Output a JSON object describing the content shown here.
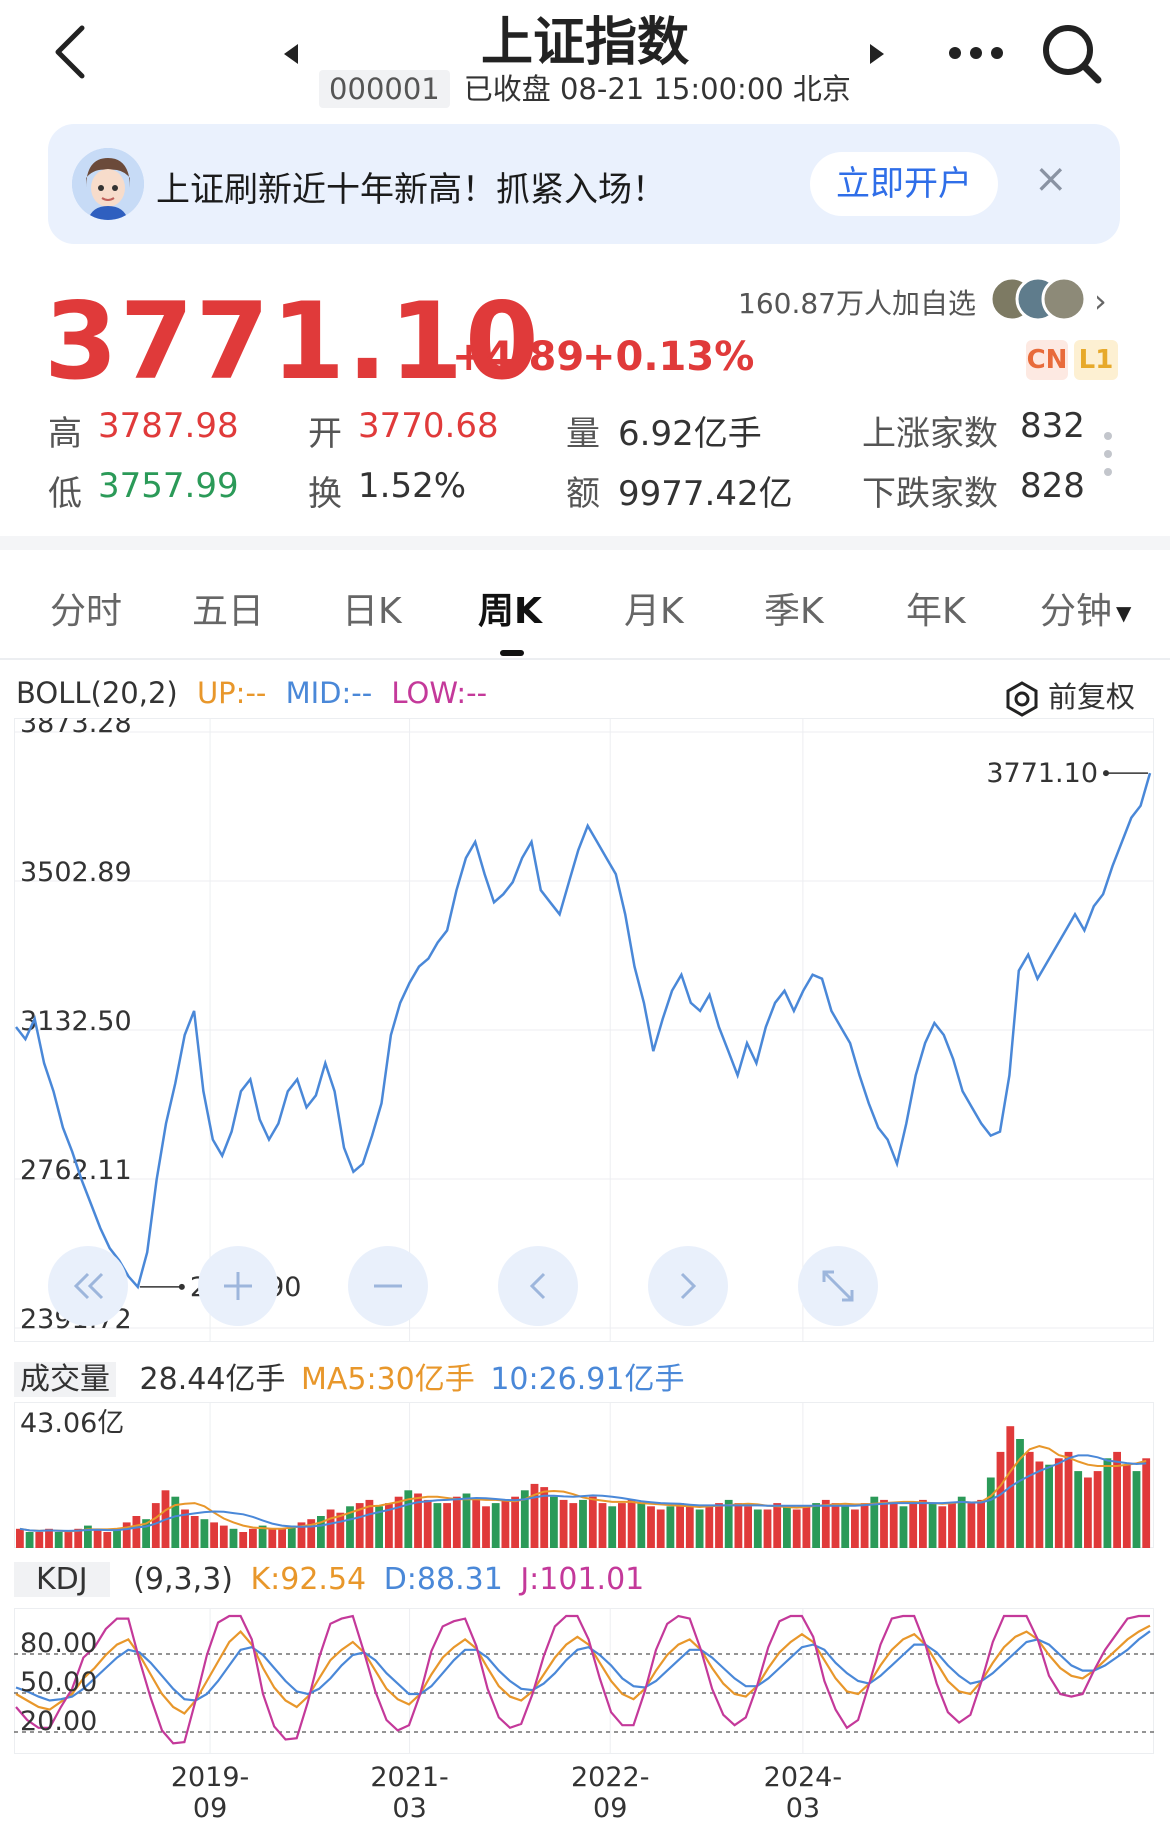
{
  "header": {
    "title": "上证指数",
    "code": "000001",
    "status": "已收盘 08-21 15:00:00 北京"
  },
  "banner": {
    "text": "上证刷新近十年新高！抓紧入场！",
    "button": "立即开户",
    "close": "×"
  },
  "quote": {
    "price": "3771.10",
    "change": "+4.89",
    "change_pct": "+0.13%",
    "watchers": "160.87万人加自选",
    "badge_cn": "CN",
    "badge_l1": "L1"
  },
  "stats": {
    "high_label": "高",
    "high": "3787.98",
    "open_label": "开",
    "open": "3770.68",
    "volume_label": "量",
    "volume": "6.92亿手",
    "up_label": "上涨家数",
    "up": "832",
    "low_label": "低",
    "low": "3757.99",
    "turnover_label": "换",
    "turnover": "1.52%",
    "amount_label": "额",
    "amount": "9977.42亿",
    "down_label": "下跌家数",
    "down": "828"
  },
  "tabs": [
    "分时",
    "五日",
    "日K",
    "周K",
    "月K",
    "季K",
    "年K",
    "分钟"
  ],
  "active_tab": "周K",
  "indicators": {
    "boll_label": "BOLL(20,2)",
    "boll_up": "UP:--",
    "boll_mid": "MID:--",
    "boll_low": "LOW:--",
    "adjust": "前复权",
    "vol_label": "成交量",
    "vol_value": "28.44亿手",
    "vol_ma5": "MA5:30亿手",
    "vol_ma10": "10:26.91亿手",
    "kdj_label": "KDJ",
    "kdj_params": "(9,3,3)",
    "kdj_k": "K:92.54",
    "kdj_d": "D:88.31",
    "kdj_j": "J:101.01"
  },
  "colors": {
    "up": "#e03a3a",
    "down": "#2b9a58",
    "line": "#4a88d8",
    "boll_up": "#e8972b",
    "boll_mid": "#4a88d8",
    "boll_low": "#c4399a"
  },
  "chart_data": [
    {
      "type": "line",
      "yticks": [
        "3873.28",
        "3502.89",
        "3132.50",
        "2762.11",
        "2391.72"
      ],
      "ylim": [
        2391.72,
        3873.28
      ],
      "x": [
        "2019-09",
        "2021-03",
        "2022-09",
        "2024-03"
      ],
      "annotations": {
        "max": "3771.10",
        "min": "2493.90"
      },
      "values": [
        3140,
        3110,
        3160,
        3050,
        2980,
        2890,
        2830,
        2760,
        2700,
        2640,
        2590,
        2560,
        2520,
        2493.9,
        2580,
        2760,
        2900,
        3000,
        3120,
        3180,
        2980,
        2860,
        2820,
        2880,
        2980,
        3010,
        2910,
        2860,
        2900,
        2980,
        3010,
        2940,
        2970,
        3050,
        2980,
        2840,
        2780,
        2800,
        2870,
        2950,
        3120,
        3200,
        3250,
        3290,
        3310,
        3350,
        3380,
        3480,
        3560,
        3600,
        3520,
        3450,
        3470,
        3500,
        3560,
        3600,
        3480,
        3450,
        3420,
        3500,
        3580,
        3640,
        3600,
        3560,
        3520,
        3420,
        3290,
        3200,
        3080,
        3160,
        3230,
        3270,
        3200,
        3180,
        3220,
        3140,
        3080,
        3020,
        3100,
        3050,
        3140,
        3200,
        3230,
        3180,
        3230,
        3270,
        3260,
        3180,
        3140,
        3100,
        3020,
        2950,
        2890,
        2860,
        2800,
        2900,
        3020,
        3100,
        3150,
        3120,
        3060,
        2980,
        2940,
        2900,
        2870,
        2880,
        3020,
        3280,
        3320,
        3260,
        3300,
        3340,
        3380,
        3420,
        3380,
        3440,
        3470,
        3540,
        3600,
        3660,
        3690,
        3771.1
      ]
    },
    {
      "type": "bar",
      "title": "成交量",
      "ytick_top": "43.06亿",
      "ylim": [
        0,
        43.06
      ],
      "values": [
        6,
        5,
        5,
        6,
        5,
        5,
        6,
        7,
        6,
        5,
        6,
        8,
        10,
        9,
        14,
        18,
        16,
        12,
        10,
        9,
        8,
        7,
        6,
        5,
        6,
        7,
        6,
        6,
        7,
        8,
        9,
        10,
        12,
        11,
        13,
        14,
        15,
        13,
        14,
        16,
        18,
        17,
        15,
        14,
        14,
        16,
        17,
        15,
        13,
        14,
        15,
        16,
        18,
        20,
        19,
        16,
        15,
        14,
        15,
        16,
        14,
        13,
        14,
        15,
        14,
        13,
        12,
        13,
        14,
        13,
        12,
        13,
        14,
        15,
        14,
        13,
        12,
        12,
        14,
        13,
        12,
        13,
        14,
        15,
        14,
        13,
        12,
        14,
        16,
        15,
        14,
        13,
        14,
        15,
        14,
        13,
        14,
        16,
        14,
        15,
        22,
        30,
        38,
        34,
        30,
        27,
        26,
        28,
        30,
        24,
        22,
        24,
        28,
        30,
        26,
        24,
        28
      ]
    },
    {
      "type": "line",
      "title": "KDJ",
      "yticks": [
        "80.00",
        "50.00",
        "20.00"
      ],
      "ylim": [
        0,
        100
      ],
      "series": [
        {
          "name": "K",
          "values": [
            40,
            35,
            30,
            28,
            34,
            40,
            52,
            60,
            70,
            78,
            82,
            70,
            55,
            40,
            30,
            25,
            35,
            50,
            65,
            80,
            88,
            78,
            60,
            45,
            35,
            30,
            38,
            52,
            66,
            74,
            80,
            72,
            58,
            44,
            36,
            32,
            40,
            55,
            68,
            76,
            82,
            75,
            60,
            46,
            38,
            35,
            42,
            55,
            68,
            78,
            84,
            78,
            64,
            50,
            40,
            36,
            44,
            58,
            70,
            78,
            82,
            74,
            60,
            48,
            40,
            38,
            46,
            60,
            72,
            80,
            86,
            80,
            66,
            52,
            42,
            40,
            48,
            62,
            74,
            82,
            86,
            78,
            64,
            50,
            42,
            40,
            50,
            64,
            76,
            84,
            88,
            82,
            70,
            60,
            54,
            52,
            58,
            66,
            74,
            82,
            88,
            92.54
          ]
        },
        {
          "name": "D",
          "values": [
            45,
            42,
            38,
            35,
            36,
            38,
            44,
            52,
            60,
            68,
            74,
            72,
            64,
            54,
            44,
            36,
            35,
            40,
            50,
            62,
            74,
            76,
            70,
            60,
            50,
            42,
            40,
            44,
            52,
            62,
            70,
            72,
            66,
            56,
            48,
            40,
            40,
            46,
            56,
            66,
            74,
            74,
            68,
            58,
            50,
            44,
            43,
            48,
            56,
            66,
            74,
            76,
            70,
            62,
            52,
            46,
            45,
            50,
            58,
            66,
            74,
            74,
            68,
            60,
            52,
            46,
            46,
            52,
            60,
            68,
            76,
            78,
            74,
            64,
            56,
            50,
            48,
            54,
            62,
            70,
            78,
            78,
            72,
            62,
            54,
            48,
            50,
            56,
            64,
            72,
            80,
            82,
            78,
            70,
            62,
            58,
            58,
            62,
            68,
            74,
            82,
            88.31
          ]
        },
        {
          "name": "J",
          "values": [
            30,
            20,
            14,
            14,
            30,
            44,
            68,
            76,
            90,
            98,
            98,
            66,
            37,
            12,
            2,
            3,
            35,
            70,
            95,
            100,
            100,
            82,
            40,
            15,
            5,
            6,
            34,
            68,
            94,
            98,
            100,
            72,
            42,
            20,
            12,
            16,
            40,
            73,
            92,
            96,
            98,
            77,
            44,
            22,
            14,
            17,
            40,
            69,
            92,
            100,
            100,
            82,
            52,
            26,
            16,
            16,
            42,
            74,
            94,
            100,
            98,
            74,
            44,
            24,
            16,
            22,
            46,
            76,
            96,
            100,
            100,
            84,
            50,
            28,
            14,
            20,
            48,
            78,
            98,
            100,
            100,
            78,
            48,
            26,
            18,
            24,
            50,
            80,
            100,
            100,
            100,
            82,
            54,
            40,
            38,
            40,
            58,
            74,
            86,
            98,
            100,
            101.01
          ]
        }
      ]
    }
  ]
}
